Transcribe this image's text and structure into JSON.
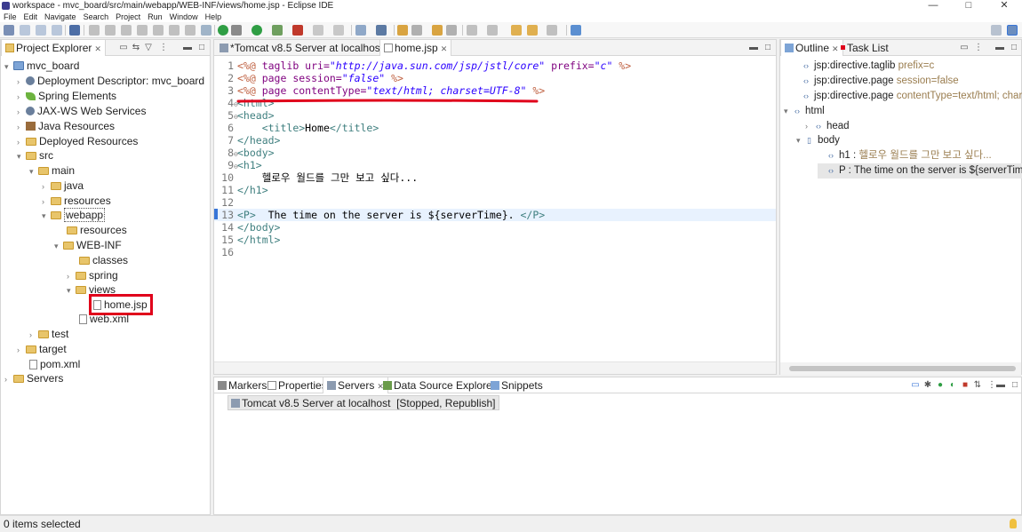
{
  "window": {
    "title": "workspace - mvc_board/src/main/webapp/WEB-INF/views/home.jsp - Eclipse IDE",
    "controls": [
      "—",
      "□",
      "✕"
    ]
  },
  "menu": [
    "File",
    "Edit",
    "Navigate",
    "Search",
    "Project",
    "Run",
    "Window",
    "Help"
  ],
  "project_explorer": {
    "tab_label": "Project Explorer",
    "items": [
      {
        "label": "mvc_board",
        "twisty": "▾"
      },
      {
        "label": "Deployment Descriptor: mvc_board",
        "twisty": "›"
      },
      {
        "label": "Spring Elements",
        "twisty": "›"
      },
      {
        "label": "JAX-WS Web Services",
        "twisty": "›"
      },
      {
        "label": "Java Resources",
        "twisty": "›"
      },
      {
        "label": "Deployed Resources",
        "twisty": "›"
      },
      {
        "label": "src",
        "twisty": "▾"
      },
      {
        "label": "main",
        "twisty": "▾"
      },
      {
        "label": "java",
        "twisty": "›"
      },
      {
        "label": "resources",
        "twisty": "›"
      },
      {
        "label": "webapp",
        "twisty": "▾"
      },
      {
        "label": "resources",
        "twisty": ""
      },
      {
        "label": "WEB-INF",
        "twisty": "▾"
      },
      {
        "label": "classes",
        "twisty": ""
      },
      {
        "label": "spring",
        "twisty": "›"
      },
      {
        "label": "views",
        "twisty": "▾"
      },
      {
        "label": "home.jsp",
        "twisty": ""
      },
      {
        "label": "web.xml",
        "twisty": ""
      },
      {
        "label": "test",
        "twisty": "›"
      },
      {
        "label": "target",
        "twisty": "›"
      },
      {
        "label": "pom.xml",
        "twisty": ""
      },
      {
        "label": "Servers",
        "twisty": "›"
      }
    ]
  },
  "editor": {
    "tabs": [
      {
        "label": "*Tomcat v8.5 Server at localhost"
      },
      {
        "label": "home.jsp"
      }
    ],
    "lines": [
      {
        "n": "1",
        "fold": " ",
        "parts": [
          [
            "c-dir",
            "<%@ "
          ],
          [
            "c-attr",
            "taglib "
          ],
          [
            "c-attr",
            "uri="
          ],
          [
            "c-val",
            "\"http://java.sun.com/jsp/jstl/core\""
          ],
          [
            "c-attr",
            " prefix="
          ],
          [
            "c-val",
            "\"c\""
          ],
          [
            "c-dir",
            " %>"
          ]
        ]
      },
      {
        "n": "2",
        "fold": " ",
        "parts": [
          [
            "c-dir",
            "<%@ "
          ],
          [
            "c-attr",
            "page "
          ],
          [
            "c-attr",
            "session="
          ],
          [
            "c-val",
            "\"false\""
          ],
          [
            "c-dir",
            " %>"
          ]
        ]
      },
      {
        "n": "3",
        "fold": " ",
        "parts": [
          [
            "c-dir",
            "<%@ "
          ],
          [
            "c-attr",
            "page "
          ],
          [
            "c-attr",
            "contentType="
          ],
          [
            "c-val",
            "\"text/html; charset=UTF-8\""
          ],
          [
            "c-dir",
            " %>"
          ]
        ]
      },
      {
        "n": "4",
        "fold": "⊖",
        "parts": [
          [
            "c-tag",
            "<html>"
          ]
        ]
      },
      {
        "n": "5",
        "fold": "⊖",
        "parts": [
          [
            "c-tag",
            "<head>"
          ]
        ]
      },
      {
        "n": "6",
        "fold": " ",
        "parts": [
          [
            "c-text",
            "    "
          ],
          [
            "c-tag",
            "<title>"
          ],
          [
            "c-text",
            "Home"
          ],
          [
            "c-tag",
            "</title>"
          ]
        ]
      },
      {
        "n": "7",
        "fold": " ",
        "parts": [
          [
            "c-tag",
            "</head>"
          ]
        ]
      },
      {
        "n": "8",
        "fold": "⊖",
        "parts": [
          [
            "c-tag",
            "<body>"
          ]
        ]
      },
      {
        "n": "9",
        "fold": "⊖",
        "parts": [
          [
            "c-tag",
            "<h1>"
          ]
        ]
      },
      {
        "n": "10",
        "fold": " ",
        "parts": [
          [
            "c-text",
            "    헬로우 월드를 그만 보고 싶다..."
          ]
        ]
      },
      {
        "n": "11",
        "fold": " ",
        "parts": [
          [
            "c-tag",
            "</h1>"
          ]
        ]
      },
      {
        "n": "12",
        "fold": " ",
        "parts": [
          [
            "c-text",
            ""
          ]
        ]
      },
      {
        "n": "13",
        "fold": " ",
        "parts": [
          [
            "c-tag",
            "<P>"
          ],
          [
            "c-text",
            "  The time on the server is ${serverTime}. "
          ],
          [
            "c-tag",
            "</P>"
          ]
        ]
      },
      {
        "n": "14",
        "fold": " ",
        "parts": [
          [
            "c-tag",
            "</body>"
          ]
        ]
      },
      {
        "n": "15",
        "fold": " ",
        "parts": [
          [
            "c-tag",
            "</html>"
          ]
        ]
      },
      {
        "n": "16",
        "fold": " ",
        "parts": [
          [
            "c-text",
            ""
          ]
        ]
      }
    ]
  },
  "outline": {
    "tabs": [
      {
        "label": "Outline"
      },
      {
        "label": "Task List"
      }
    ],
    "rows": [
      {
        "twisty": "",
        "icon": "‹›",
        "label": "jsp:directive.taglib",
        "detail": " prefix=c"
      },
      {
        "twisty": "",
        "icon": "‹›",
        "label": "jsp:directive.page",
        "detail": " session=false"
      },
      {
        "twisty": "",
        "icon": "‹›",
        "label": "jsp:directive.page",
        "detail": " contentType=text/html; charset"
      },
      {
        "twisty": "▾",
        "icon": "‹›",
        "label": "html",
        "detail": ""
      },
      {
        "twisty": "›",
        "icon": "‹›",
        "label": "head",
        "detail": ""
      },
      {
        "twisty": "▾",
        "icon": "▯",
        "label": "body",
        "detail": ""
      },
      {
        "twisty": "",
        "icon": "‹›",
        "label": "h1 : ",
        "detail": "헬로우 월드를 그만 보고 싶다..."
      },
      {
        "twisty": "",
        "icon": "‹›",
        "label": "P : The time on the server is ${serverTime}.",
        "detail": ""
      }
    ]
  },
  "bottom": {
    "tabs": [
      {
        "label": "Markers"
      },
      {
        "label": "Properties"
      },
      {
        "label": "Servers"
      },
      {
        "label": "Data Source Explorer"
      },
      {
        "label": "Snippets"
      }
    ],
    "server_row": "Tomcat v8.5 Server at localhost  [Stopped, Republish]"
  },
  "status_bar": {
    "text": "0 items selected"
  },
  "colors": {
    "highlight_red": "#e0001b",
    "selection_blue": "#cce4f7",
    "accent": "#3875d7"
  }
}
